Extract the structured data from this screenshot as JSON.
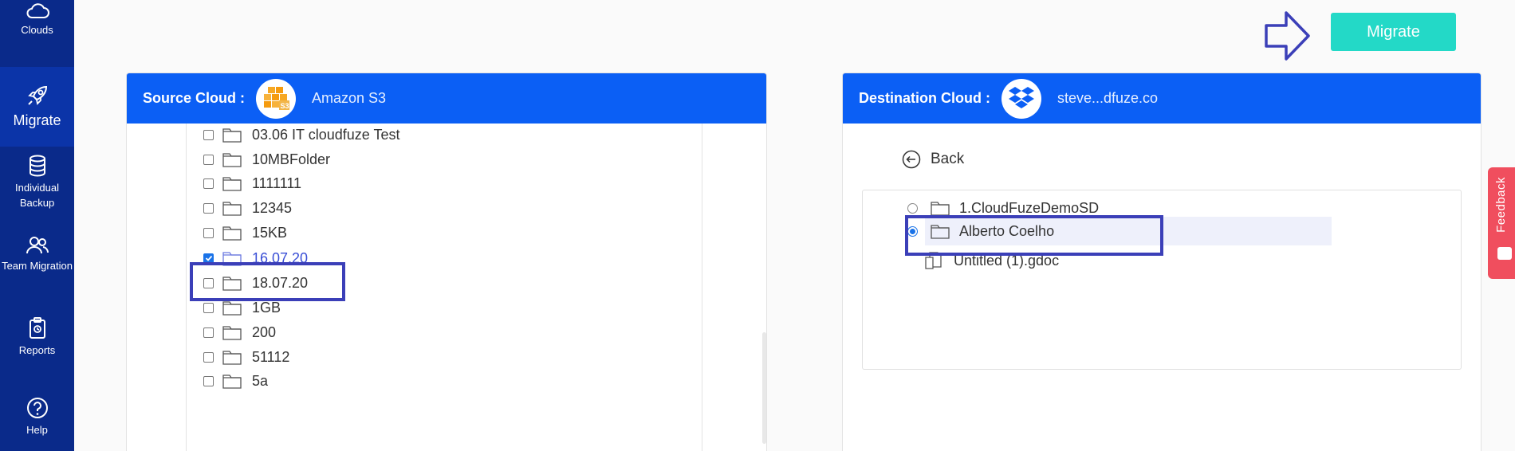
{
  "sidebar": {
    "items": [
      {
        "label": "Clouds",
        "icon": "cloud-icon"
      },
      {
        "label": "Migrate",
        "icon": "rocket-icon",
        "active": true
      },
      {
        "label": "Individual Backup",
        "icon": "database-icon"
      },
      {
        "label": "Team Migration",
        "icon": "team-icon"
      },
      {
        "label": "Reports",
        "icon": "clipboard-icon"
      },
      {
        "label": "Help",
        "icon": "help-icon"
      }
    ]
  },
  "toolbar": {
    "migrate_label": "Migrate"
  },
  "source": {
    "title": "Source Cloud :",
    "cloud_name": "Amazon S3",
    "items": [
      {
        "name": "03.06 IT cloudfuze Test",
        "checked": false
      },
      {
        "name": "10MBFolder",
        "checked": false
      },
      {
        "name": "1111111",
        "checked": false
      },
      {
        "name": "12345",
        "checked": false
      },
      {
        "name": "15KB",
        "checked": false
      },
      {
        "name": "16.07.20",
        "checked": true
      },
      {
        "name": "18.07.20",
        "checked": false
      },
      {
        "name": "1GB",
        "checked": false
      },
      {
        "name": "200",
        "checked": false
      },
      {
        "name": "51112",
        "checked": false
      },
      {
        "name": "5a",
        "checked": false
      }
    ]
  },
  "destination": {
    "title": "Destination Cloud :",
    "cloud_name": "steve...dfuze.co",
    "back_label": "Back",
    "items": [
      {
        "name": "1.CloudFuzeDemoSD",
        "type": "folder",
        "selected": false
      },
      {
        "name": "Alberto Coelho",
        "type": "folder",
        "selected": true
      },
      {
        "name": "Untitled (1).gdoc",
        "type": "file",
        "selected": false
      }
    ]
  },
  "feedback": {
    "label": "Feedback"
  },
  "colors": {
    "sidebar": "#0a2a8a",
    "header": "#0b5ff5",
    "migrate_button": "#23d9c7",
    "highlight": "#3b3fb8",
    "feedback": "#f04e5e"
  }
}
